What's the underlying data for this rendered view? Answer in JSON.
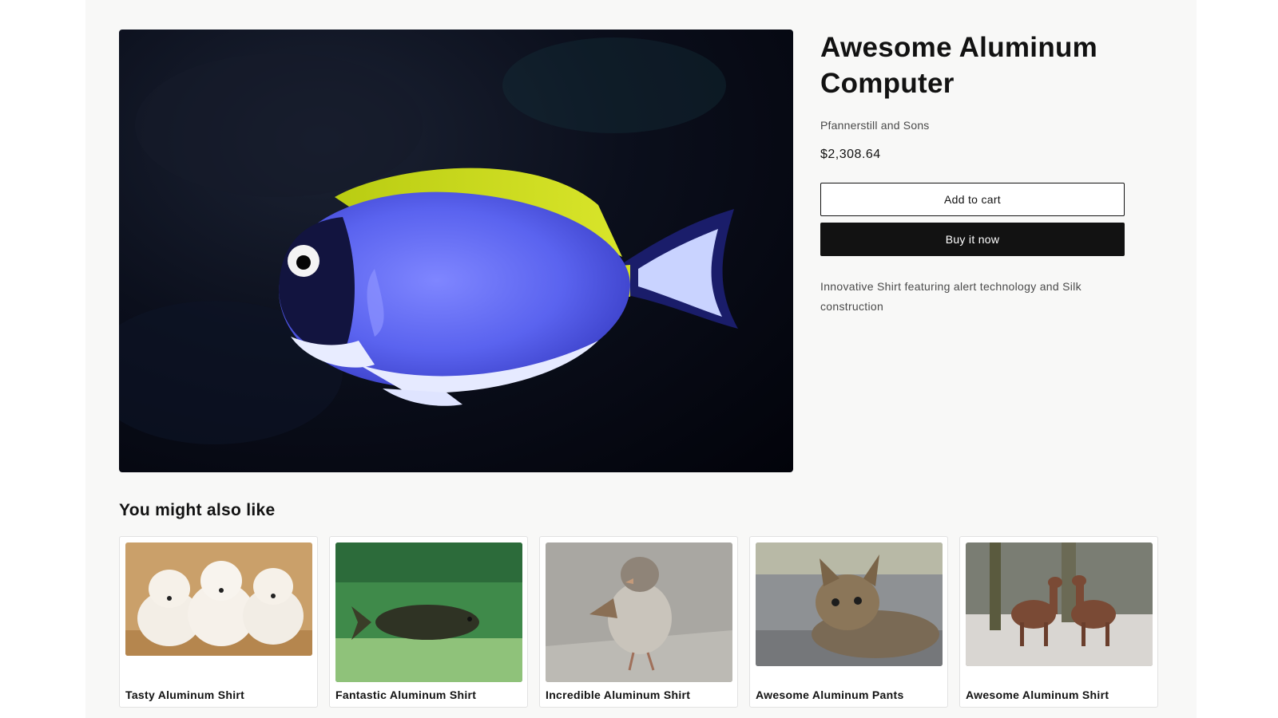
{
  "product": {
    "title_line1": "Awesome Aluminum",
    "title_line2": "Computer",
    "vendor": "Pfannerstill and Sons",
    "price": "$2,308.64",
    "description": "Innovative Shirt featuring alert technology and Silk construction",
    "image_subject": "blue tang fish"
  },
  "actions": {
    "add_to_cart_label": "Add to cart",
    "buy_now_label": "Buy it now"
  },
  "related": {
    "heading": "You might also like",
    "items": [
      {
        "title": "Tasty Aluminum Shirt",
        "image_subject": "golden retriever puppies"
      },
      {
        "title": "Fantastic Aluminum Shirt",
        "image_subject": "fish underwater"
      },
      {
        "title": "Incredible Aluminum Shirt",
        "image_subject": "sparrow"
      },
      {
        "title": "Awesome Aluminum Pants",
        "image_subject": "kitten"
      },
      {
        "title": "Awesome Aluminum Shirt",
        "image_subject": "alpacas"
      }
    ]
  },
  "colors": {
    "page_background": "#f8f8f7",
    "text": "#121212",
    "buy_button": "#121212"
  }
}
